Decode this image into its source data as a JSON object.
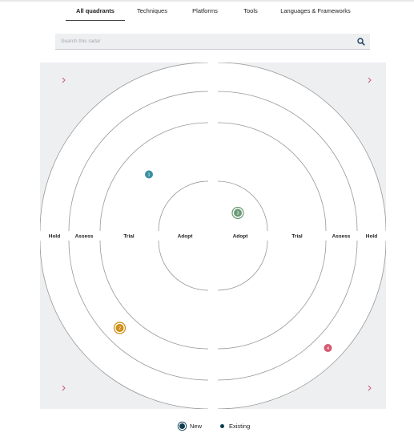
{
  "nav": {
    "tabs": [
      {
        "label": "All quadrants",
        "active": true
      },
      {
        "label": "Techniques",
        "active": false
      },
      {
        "label": "Platforms",
        "active": false
      },
      {
        "label": "Tools",
        "active": false
      },
      {
        "label": "Languages & Frameworks",
        "active": false
      }
    ]
  },
  "search": {
    "placeholder": "Search this radar",
    "value": "",
    "icon": "search-icon"
  },
  "radar": {
    "rings_left": [
      "Hold",
      "Assess",
      "Trial",
      "Adopt"
    ],
    "rings_right": [
      "Adopt",
      "Trial",
      "Assess",
      "Hold"
    ],
    "expand_icon": "chevron-right-icon",
    "blips": [
      {
        "number": "1",
        "color": "#3a8fa3",
        "status": "existing"
      },
      {
        "number": "2",
        "color": "#cf8d14",
        "status": "new"
      },
      {
        "number": "3",
        "color": "#6a9a76",
        "status": "new"
      },
      {
        "number": "4",
        "color": "#d45b72",
        "status": "existing"
      }
    ]
  },
  "legend": {
    "new_label": "New",
    "existing_label": "Existing",
    "color": "#0c3d4f"
  },
  "colors": {
    "quadrant_bg": "#edeff1",
    "ring_stroke": "#999999",
    "chevron": "#d0607a"
  }
}
